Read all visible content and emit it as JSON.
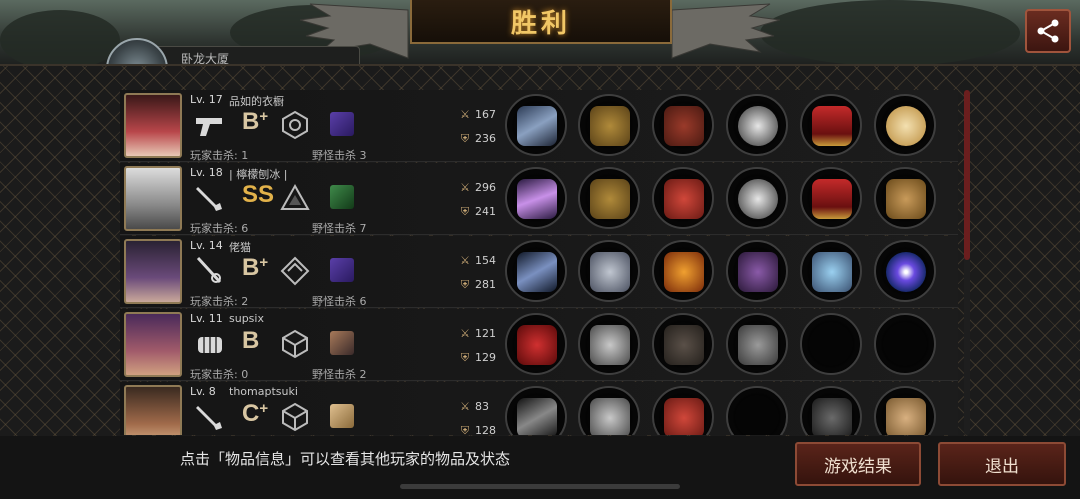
{
  "header": {
    "title": "胜利",
    "truncated_chip": "卧龙大厦"
  },
  "players": [
    {
      "level": "Lv. 17",
      "name": "品如的衣橱",
      "grade": "B",
      "grade_plus": "+",
      "player_kills": "玩家击杀: 1",
      "monster_kills": "野怪击杀 3",
      "attack": "167",
      "defense": "236"
    },
    {
      "level": "Lv. 18",
      "name": "| 檸檬刨冰 |",
      "grade": "SS",
      "grade_plus": "",
      "player_kills": "玩家击杀: 6",
      "monster_kills": "野怪击杀 7",
      "attack": "296",
      "defense": "241"
    },
    {
      "level": "Lv. 14",
      "name": "佬猫",
      "grade": "B",
      "grade_plus": "+",
      "player_kills": "玩家击杀: 2",
      "monster_kills": "野怪击杀 6",
      "attack": "154",
      "defense": "281"
    },
    {
      "level": "Lv. 11",
      "name": "supsix",
      "grade": "B",
      "grade_plus": "",
      "player_kills": "玩家击杀: 0",
      "monster_kills": "野怪击杀 2",
      "attack": "121",
      "defense": "129"
    },
    {
      "level": "Lv. 8",
      "name": "thomaptsuki",
      "grade": "C",
      "grade_plus": "+",
      "player_kills": "",
      "monster_kills": "",
      "attack": "83",
      "defense": "128"
    }
  ],
  "footer": {
    "hint": "点击「物品信息」可以查看其他玩家的物品及状态",
    "result_button": "游戏结果",
    "exit_button": "退出"
  },
  "icons": {
    "attack": "crossed-swords-icon",
    "defense": "shield-icon",
    "share": "share-icon"
  },
  "colors": {
    "title_gold": "#f1c766",
    "button_red": "#5a241a",
    "frame_gold": "#8f7a55"
  }
}
